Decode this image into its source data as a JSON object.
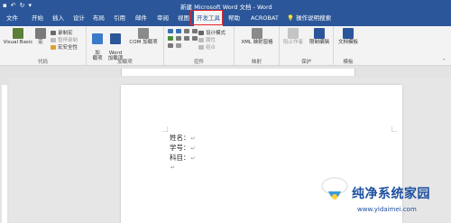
{
  "titlebar": {
    "title": "新建 Microsoft Word 文档 - Word"
  },
  "tabs": [
    {
      "label": "文件"
    },
    {
      "label": "开始"
    },
    {
      "label": "插入"
    },
    {
      "label": "设计"
    },
    {
      "label": "布局"
    },
    {
      "label": "引用"
    },
    {
      "label": "邮件"
    },
    {
      "label": "审阅"
    },
    {
      "label": "视图"
    },
    {
      "label": "开发工具"
    },
    {
      "label": "帮助"
    },
    {
      "label": "ACROBAT"
    },
    {
      "label": "操作说明搜索"
    }
  ],
  "ribbon": {
    "code": {
      "label": "代码",
      "visual_basic": "Visual Basic",
      "macros": "宏",
      "record_macro": "录制宏",
      "pause_recording": "暂停录制",
      "macro_security": "宏安全性"
    },
    "addins": {
      "label": "加载项",
      "addins": "加\n载项",
      "word_addins": "Word\n加载项",
      "com_addins": "COM 加载项"
    },
    "controls": {
      "label": "控件",
      "design_mode": "设计模式",
      "properties": "属性",
      "group": "组合"
    },
    "mapping": {
      "label": "映射",
      "xml_mapping": "XML 映射窗格"
    },
    "protect": {
      "label": "保护",
      "block_authors": "阻止作者",
      "restrict_editing": "限制编辑"
    },
    "templates": {
      "label": "模板",
      "document_template": "文档模板"
    }
  },
  "document": {
    "lines": [
      "姓名：",
      "学号：",
      "科目："
    ],
    "pilcrow": "↵"
  },
  "watermark": {
    "text": "纯净系统家园",
    "url": "www.yidaimei.com"
  },
  "colors": {
    "accent": "#2b579a",
    "highlight": "#e8242a"
  }
}
